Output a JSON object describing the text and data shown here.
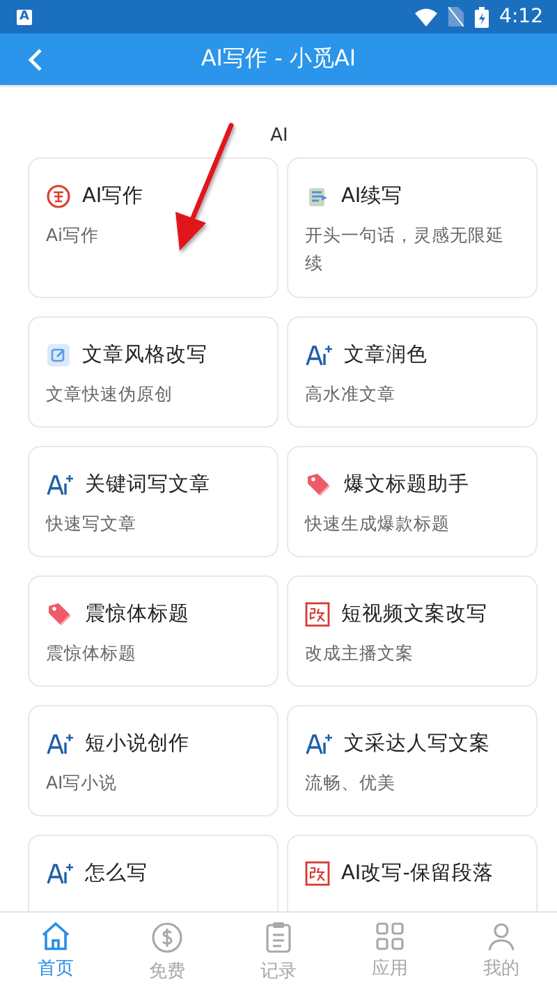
{
  "status_bar": {
    "notification": "A",
    "time": "4:12",
    "sim_missing": true
  },
  "app_bar": {
    "title": "AI写作 - 小觅AI"
  },
  "section": {
    "label": "AI"
  },
  "cards": [
    {
      "kind": "seal",
      "title": "AI写作",
      "description": "Ai写作"
    },
    {
      "kind": "notepad",
      "title": "AI续写",
      "description": "开头一句话，灵感无限延续"
    },
    {
      "kind": "edit",
      "title": "文章风格改写",
      "description": "文章快速伪原创"
    },
    {
      "kind": "ai",
      "title": "文章润色",
      "description": "高水准文章"
    },
    {
      "kind": "ai",
      "title": "关键词写文章",
      "description": "快速写文章"
    },
    {
      "kind": "tag",
      "title": "爆文标题助手",
      "description": "快速生成爆款标题"
    },
    {
      "kind": "tag",
      "title": "震惊体标题",
      "description": "震惊体标题"
    },
    {
      "kind": "stamp",
      "title": "短视频文案改写",
      "description": "改成主播文案"
    },
    {
      "kind": "ai",
      "title": "短小说创作",
      "description": "AI写小说"
    },
    {
      "kind": "ai",
      "title": "文采达人写文案",
      "description": "流畅、优美"
    },
    {
      "kind": "ai",
      "title": "怎么写"
    },
    {
      "kind": "stamp",
      "title": "AI改写-保留段落"
    }
  ],
  "bottom_nav": [
    {
      "kind": "home",
      "label": "首页",
      "selected": true
    },
    {
      "kind": "coin",
      "label": "免费",
      "selected": false
    },
    {
      "kind": "clipboard",
      "label": "记录",
      "selected": false
    },
    {
      "kind": "apps",
      "label": "应用",
      "selected": false
    },
    {
      "kind": "person",
      "label": "我的",
      "selected": false
    }
  ]
}
